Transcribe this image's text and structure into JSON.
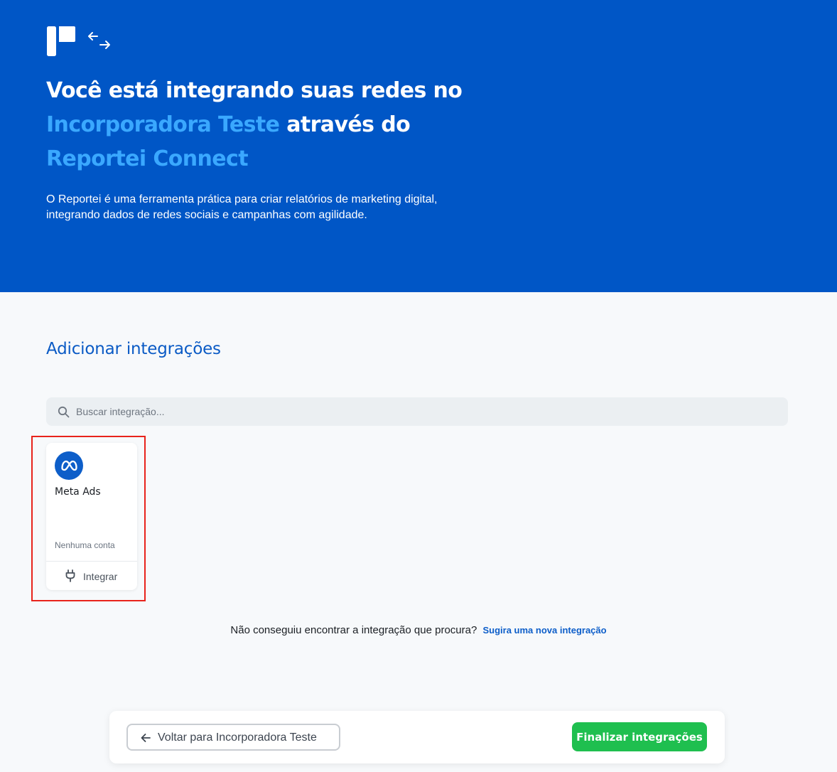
{
  "hero": {
    "title_part1": "Você está integrando suas redes no ",
    "company": "Incorporadora Teste",
    "title_part2": " através do ",
    "product": "Reportei Connect",
    "description": "O Reportei é uma ferramenta prática para criar relatórios de marketing digital, integrando dados de redes sociais e campanhas com agilidade.",
    "logo_icon": "reportei-logo-icon",
    "arrows_icon": "arrows-exchange-icon"
  },
  "integrations": {
    "title": "Adicionar integrações",
    "search": {
      "placeholder": "Buscar integração...",
      "value": "",
      "icon": "search-icon"
    },
    "items": [
      {
        "name": "Meta Ads",
        "status": "Nenhuma conta",
        "action_label": "Integrar",
        "icon": "meta-icon",
        "action_icon": "plug-icon",
        "icon_color": "#0d5ec9"
      }
    ]
  },
  "suggest": {
    "text": "Não conseguiu encontrar a integração que procura?",
    "link": "Sugira uma nova integração"
  },
  "footer": {
    "back_label": "Voltar para Incorporadora Teste",
    "finish_label": "Finalizar integrações"
  },
  "colors": {
    "hero_bg": "#0056c6",
    "highlight": "#3aa8ff",
    "accent": "#0d5ec9",
    "success": "#1fbf4f",
    "selection_frame": "#e8231b"
  }
}
